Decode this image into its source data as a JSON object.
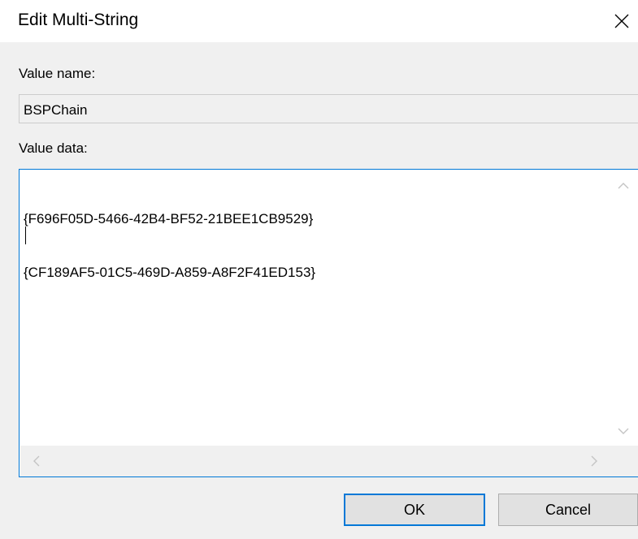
{
  "dialog": {
    "title": "Edit Multi-String"
  },
  "value_name": {
    "label": "Value name:",
    "value": "BSPChain"
  },
  "value_data": {
    "label": "Value data:",
    "lines": [
      "{F696F05D-5466-42B4-BF52-21BEE1CB9529}",
      "{CF189AF5-01C5-469D-A859-A8F2F41ED153}"
    ]
  },
  "buttons": {
    "ok": "OK",
    "cancel": "Cancel"
  },
  "icons": {
    "close": "close-icon",
    "scroll_up": "chevron-up-icon",
    "scroll_down": "chevron-down-icon",
    "scroll_left": "chevron-left-icon",
    "scroll_right": "chevron-right-icon"
  },
  "colors": {
    "focus_border": "#0078d7",
    "dialog_background": "#f0f0f0",
    "button_face": "#e1e1e1"
  }
}
